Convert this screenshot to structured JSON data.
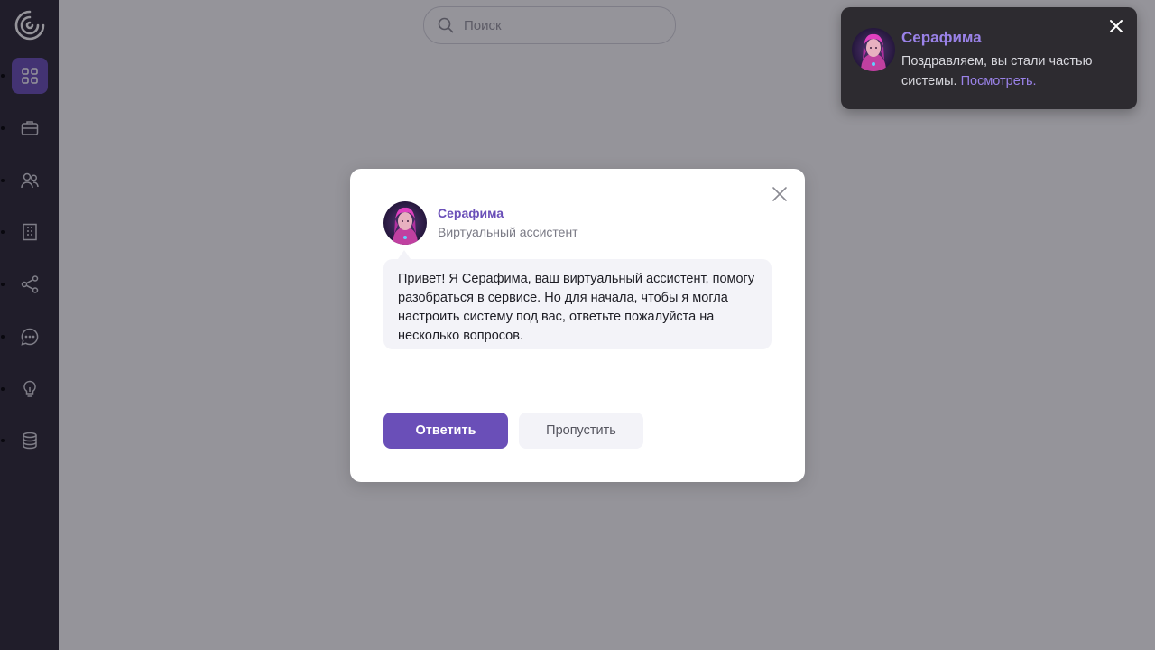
{
  "app": {
    "search": {
      "placeholder": "Поиск",
      "value": ""
    }
  },
  "sidebar": {
    "items": [
      {
        "icon": "grid-icon",
        "active": true
      },
      {
        "icon": "briefcase-icon",
        "active": false
      },
      {
        "icon": "users-icon",
        "active": false
      },
      {
        "icon": "building-icon",
        "active": false
      },
      {
        "icon": "share-icon",
        "active": false
      },
      {
        "icon": "chat-icon",
        "active": false
      },
      {
        "icon": "lightbulb-icon",
        "active": false
      },
      {
        "icon": "database-icon",
        "active": false
      }
    ]
  },
  "modal": {
    "sender_name": "Серафима",
    "sender_role": "Виртуальный ассистент",
    "message": "Привет! Я Серафима, ваш виртуальный ассистент, помогу разобраться в сервисе. Но для начала, чтобы я могла настроить систему под вас, ответьте пожалуйста на несколько вопросов.",
    "reply_label": "Ответить",
    "skip_label": "Пропустить"
  },
  "toast": {
    "title": "Серафима",
    "text": "Поздравляем, вы стали частью системы.",
    "link_label": "Посмотреть."
  },
  "colors": {
    "accent": "#6a4fb8",
    "sidebar_bg": "#2a2733",
    "toast_bg": "#2d2b30",
    "toast_accent": "#9a82e8"
  }
}
